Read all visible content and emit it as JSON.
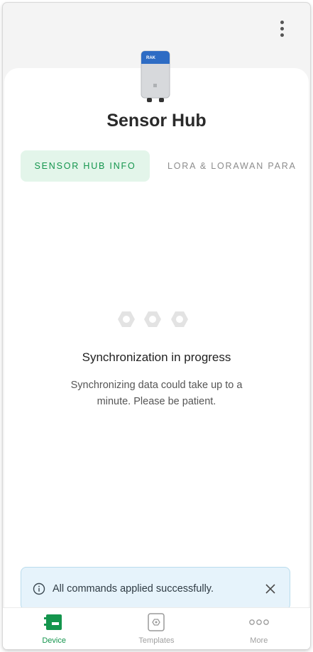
{
  "header": {
    "menu_icon": "more-vertical-icon"
  },
  "device": {
    "image_icon": "sensor-hub-device-icon",
    "image_brand": "RAK",
    "title": "Sensor Hub"
  },
  "tabs": [
    {
      "label": "SENSOR HUB INFO",
      "active": true
    },
    {
      "label": "LORA & LORAWAN PARA",
      "active": false
    }
  ],
  "sync": {
    "loader_icon": "hexagon-loader-icon",
    "title": "Synchronization in progress",
    "subtitle": "Synchronizing data could take up to a minute. Please be patient."
  },
  "toast": {
    "icon": "info-icon",
    "message": "All commands applied successfully.",
    "close_icon": "close-icon"
  },
  "bottom_nav": [
    {
      "label": "Device",
      "icon": "device-icon",
      "active": true
    },
    {
      "label": "Templates",
      "icon": "templates-icon",
      "active": false
    },
    {
      "label": "More",
      "icon": "more-horizontal-icon",
      "active": false
    }
  ],
  "colors": {
    "accent": "#14954d",
    "active_tab_bg": "#e3f5ea",
    "toast_bg": "#e6f3fb",
    "device_blue": "#2e6cc4"
  }
}
